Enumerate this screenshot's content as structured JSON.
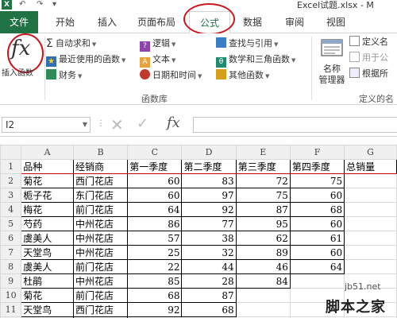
{
  "window": {
    "app_logo": "X",
    "title": "Excel试题.xlsx - M",
    "quick_access": [
      "↶",
      "↷",
      "▾"
    ],
    "brand_color": "#217346"
  },
  "tabs": [
    {
      "label": "文件",
      "active": false
    },
    {
      "label": "开始",
      "active": false
    },
    {
      "label": "插入",
      "active": false
    },
    {
      "label": "页面布局",
      "active": false
    },
    {
      "label": "公式",
      "active": true
    },
    {
      "label": "数据",
      "active": false
    },
    {
      "label": "审阅",
      "active": false
    },
    {
      "label": "视图",
      "active": false
    }
  ],
  "ribbon": {
    "insert_function": {
      "glyph": "fx",
      "label": "插入函数"
    },
    "library": {
      "group_label": "函数库",
      "items": [
        {
          "label": "自动求和",
          "icon": "sigma-icon"
        },
        {
          "label": "最近使用的函数",
          "icon": "star-icon"
        },
        {
          "label": "财务",
          "icon": "book-icon"
        },
        {
          "label": "逻辑",
          "icon": "question-book-icon"
        },
        {
          "label": "文本",
          "icon": "text-icon"
        },
        {
          "label": "日期和时间",
          "icon": "clock-icon"
        },
        {
          "label": "查找与引用",
          "icon": "search-book-icon"
        },
        {
          "label": "数学和三角函数",
          "icon": "theta-icon"
        },
        {
          "label": "其他函数",
          "icon": "more-functions-icon"
        }
      ]
    },
    "defined_names": {
      "group_label": "定义的名",
      "name_manager": "名称\n管理器",
      "define_name": "定义名",
      "use_in_formula": "用于公",
      "create_from_selection": "根据所"
    }
  },
  "formula_bar": {
    "name_box": "I2",
    "cancel": "✕",
    "enter": "✓",
    "fx": "fx",
    "content": ""
  },
  "sheet": {
    "columns": [
      "A",
      "B",
      "C",
      "D",
      "E",
      "F",
      "G"
    ],
    "row_numbers": [
      "1",
      "2",
      "3",
      "4",
      "5",
      "6",
      "7",
      "8",
      "9",
      "10",
      "11",
      "12"
    ],
    "headers": [
      "品种",
      "经销商",
      "第一季度",
      "第二季度",
      "第三季度",
      "第四季度",
      "总销量"
    ],
    "rows": [
      [
        "菊花",
        "西门花店",
        "60",
        "83",
        "72",
        "75"
      ],
      [
        "栀子花",
        "东门花店",
        "60",
        "97",
        "75",
        "60"
      ],
      [
        "梅花",
        "前门花店",
        "64",
        "92",
        "87",
        "68"
      ],
      [
        "芍药",
        "中州花店",
        "86",
        "77",
        "95",
        "60"
      ],
      [
        "虞美人",
        "中州花店",
        "57",
        "38",
        "62",
        "61"
      ],
      [
        "天堂鸟",
        "中州花店",
        "25",
        "32",
        "89",
        "60"
      ],
      [
        "虞美人",
        "前门花店",
        "22",
        "44",
        "46",
        "64"
      ],
      [
        "杜鹃",
        "中州花店",
        "85",
        "28",
        "84",
        ""
      ],
      [
        "菊花",
        "前门花店",
        "68",
        "87",
        "",
        ""
      ],
      [
        "天堂鸟",
        "西门花店",
        "92",
        "68",
        "",
        ""
      ],
      [
        "芍药",
        "东门花店",
        "",
        "",
        "",
        ""
      ]
    ]
  },
  "watermark": {
    "url": "jb51.net",
    "site_name": "脚本之家"
  },
  "colors": {
    "highlight_oval": "#c8161d",
    "header_underline": "#c00000",
    "tab_active_text": "#217346"
  }
}
